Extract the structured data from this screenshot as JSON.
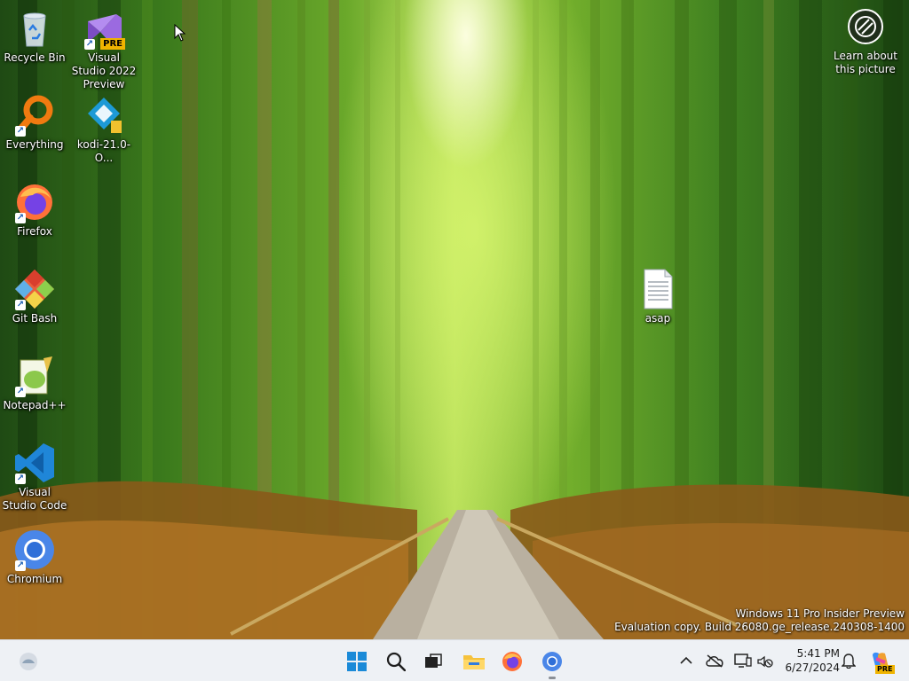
{
  "desktop": {
    "icons": [
      {
        "label": "Recycle Bin",
        "icon": "recycle-bin-icon"
      },
      {
        "label": "Visual Studio 2022 Preview",
        "badge": "PRE",
        "icon": "visual-studio-preview-icon"
      },
      {
        "label": "Everything",
        "icon": "everything-search-icon"
      },
      {
        "label": "kodi-21.0-O...",
        "icon": "kodi-installer-icon"
      },
      {
        "label": "Firefox",
        "icon": "firefox-icon"
      },
      {
        "label": "Git Bash",
        "icon": "git-bash-icon"
      },
      {
        "label": "Notepad++",
        "icon": "notepad-plus-plus-icon"
      },
      {
        "label": "Visual Studio Code",
        "icon": "vscode-icon"
      },
      {
        "label": "Chromium",
        "icon": "chromium-icon"
      },
      {
        "label": "asap",
        "icon": "text-file-icon"
      }
    ],
    "learn_about_picture": "Learn about this picture",
    "watermark": {
      "line1": "Windows 11 Pro Insider Preview",
      "line2": "Evaluation copy. Build 26080.ge_release.240308-1400"
    }
  },
  "taskbar": {
    "pinned": [
      "widgets-icon",
      "start-icon",
      "search-icon",
      "task-view-icon",
      "file-explorer-icon",
      "firefox-icon",
      "chromium-icon"
    ],
    "tray": [
      "show-hidden-icons-chevron",
      "onedrive-offline-icon",
      "display-icon",
      "network-volume-icon",
      "notifications-bell-icon",
      "copilot-icon"
    ],
    "clock": {
      "time": "5:41 PM",
      "date": "6/27/2024"
    },
    "copilot_badge": "PRE"
  }
}
